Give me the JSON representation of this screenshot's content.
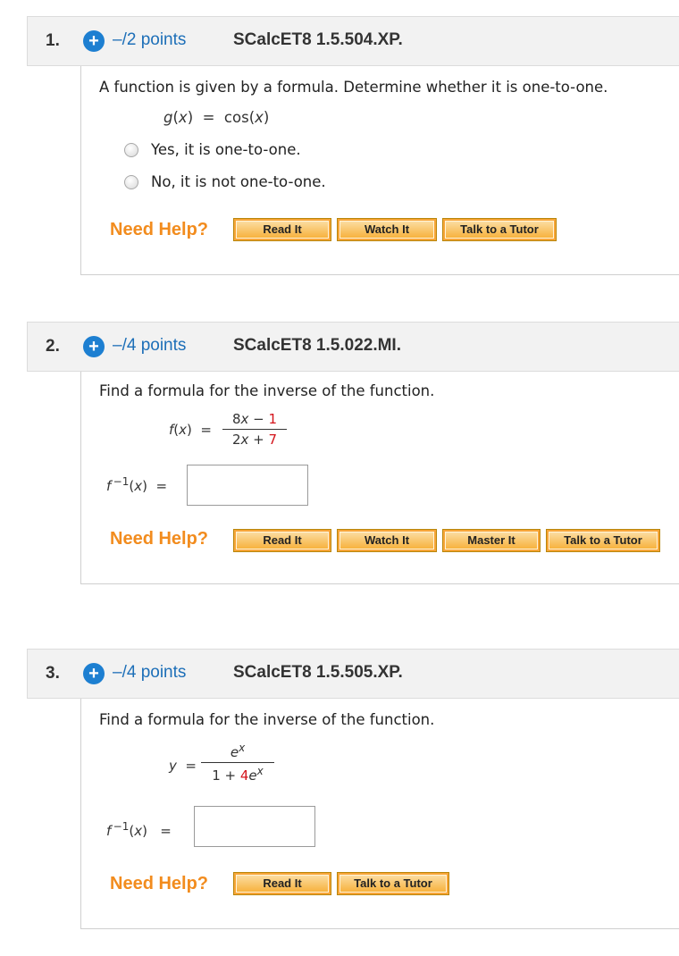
{
  "questions": [
    {
      "number": "1.",
      "points": "–/2 points",
      "code": "SCalcET8 1.5.504.XP.",
      "prompt": "A function is given by a formula. Determine whether it is one-to-one.",
      "formula": "g(x) = cos(x)",
      "options": [
        "Yes, it is one-to-one.",
        "No, it is not one-to-one."
      ],
      "need_help": "Need Help?",
      "buttons": [
        "Read It",
        "Watch It",
        "Talk to a Tutor"
      ]
    },
    {
      "number": "2.",
      "points": "–/4 points",
      "code": "SCalcET8 1.5.022.MI.",
      "prompt": "Find a formula for the inverse of the function.",
      "lhs": "f(x) =",
      "numerator_a": "8x − ",
      "numerator_b": "1",
      "denominator_a": "2x + ",
      "denominator_b": "7",
      "answer_label": "f −1(x) =",
      "answer_value": "",
      "need_help": "Need Help?",
      "buttons": [
        "Read It",
        "Watch It",
        "Master It",
        "Talk to a Tutor"
      ]
    },
    {
      "number": "3.",
      "points": "–/4 points",
      "code": "SCalcET8 1.5.505.XP.",
      "prompt": "Find a formula for the inverse of the function.",
      "lhs": "y =",
      "numerator": "ex",
      "denominator_a": "1 + ",
      "denominator_b": "4",
      "denominator_c": "ex",
      "answer_label": "f −1(x) =",
      "answer_value": "",
      "need_help": "Need Help?",
      "buttons": [
        "Read It",
        "Talk to a Tutor"
      ]
    }
  ]
}
